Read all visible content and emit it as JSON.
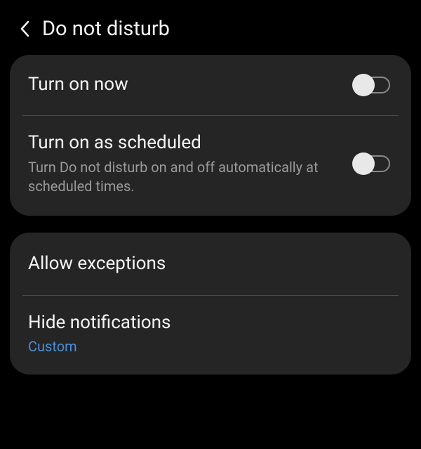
{
  "header": {
    "title": "Do not disturb"
  },
  "group1": {
    "turn_on_now": {
      "title": "Turn on now",
      "enabled": false
    },
    "turn_on_scheduled": {
      "title": "Turn on as scheduled",
      "subtitle": "Turn Do not disturb on and off automatically at scheduled times.",
      "enabled": false
    }
  },
  "group2": {
    "allow_exceptions": {
      "title": "Allow exceptions"
    },
    "hide_notifications": {
      "title": "Hide notifications",
      "value": "Custom"
    }
  },
  "colors": {
    "background": "#000000",
    "card": "#252525",
    "text_primary": "#f5f5f5",
    "text_secondary": "#9a9a9a",
    "accent": "#4a8fd6",
    "divider": "#4a4a4a",
    "toggle_border": "#8a8a8a",
    "toggle_thumb": "#e8e8e8"
  }
}
